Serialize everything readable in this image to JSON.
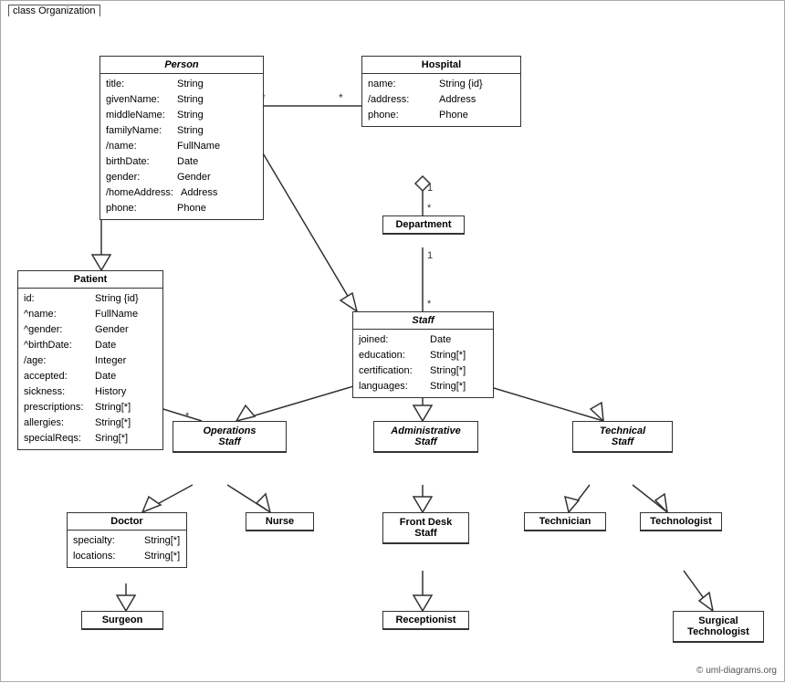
{
  "diagram": {
    "title": "class Organization",
    "copyright": "© uml-diagrams.org",
    "classes": {
      "person": {
        "name": "Person",
        "italic": true,
        "attrs": [
          {
            "name": "title:",
            "type": "String"
          },
          {
            "name": "givenName:",
            "type": "String"
          },
          {
            "name": "middleName:",
            "type": "String"
          },
          {
            "name": "familyName:",
            "type": "String"
          },
          {
            "name": "/name:",
            "type": "FullName"
          },
          {
            "name": "birthDate:",
            "type": "Date"
          },
          {
            "name": "gender:",
            "type": "Gender"
          },
          {
            "name": "/homeAddress:",
            "type": "Address"
          },
          {
            "name": "phone:",
            "type": "Phone"
          }
        ]
      },
      "hospital": {
        "name": "Hospital",
        "italic": false,
        "attrs": [
          {
            "name": "name:",
            "type": "String {id}"
          },
          {
            "name": "/address:",
            "type": "Address"
          },
          {
            "name": "phone:",
            "type": "Phone"
          }
        ]
      },
      "patient": {
        "name": "Patient",
        "italic": false,
        "attrs": [
          {
            "name": "id:",
            "type": "String {id}"
          },
          {
            "name": "^name:",
            "type": "FullName"
          },
          {
            "name": "^gender:",
            "type": "Gender"
          },
          {
            "name": "^birthDate:",
            "type": "Date"
          },
          {
            "name": "/age:",
            "type": "Integer"
          },
          {
            "name": "accepted:",
            "type": "Date"
          },
          {
            "name": "sickness:",
            "type": "History"
          },
          {
            "name": "prescriptions:",
            "type": "String[*]"
          },
          {
            "name": "allergies:",
            "type": "String[*]"
          },
          {
            "name": "specialReqs:",
            "type": "Sring[*]"
          }
        ]
      },
      "department": {
        "name": "Department",
        "italic": false,
        "attrs": []
      },
      "staff": {
        "name": "Staff",
        "italic": true,
        "attrs": [
          {
            "name": "joined:",
            "type": "Date"
          },
          {
            "name": "education:",
            "type": "String[*]"
          },
          {
            "name": "certification:",
            "type": "String[*]"
          },
          {
            "name": "languages:",
            "type": "String[*]"
          }
        ]
      },
      "operations_staff": {
        "name": "Operations Staff",
        "italic": true
      },
      "administrative_staff": {
        "name": "Administrative Staff",
        "italic": true
      },
      "technical_staff": {
        "name": "Technical Staff",
        "italic": true
      },
      "doctor": {
        "name": "Doctor",
        "italic": false,
        "attrs": [
          {
            "name": "specialty:",
            "type": "String[*]"
          },
          {
            "name": "locations:",
            "type": "String[*]"
          }
        ]
      },
      "nurse": {
        "name": "Nurse",
        "italic": false
      },
      "front_desk_staff": {
        "name": "Front Desk Staff",
        "italic": false
      },
      "technician": {
        "name": "Technician",
        "italic": false
      },
      "technologist": {
        "name": "Technologist",
        "italic": false
      },
      "surgeon": {
        "name": "Surgeon",
        "italic": false
      },
      "receptionist": {
        "name": "Receptionist",
        "italic": false
      },
      "surgical_technologist": {
        "name": "Surgical Technologist",
        "italic": false
      }
    }
  }
}
